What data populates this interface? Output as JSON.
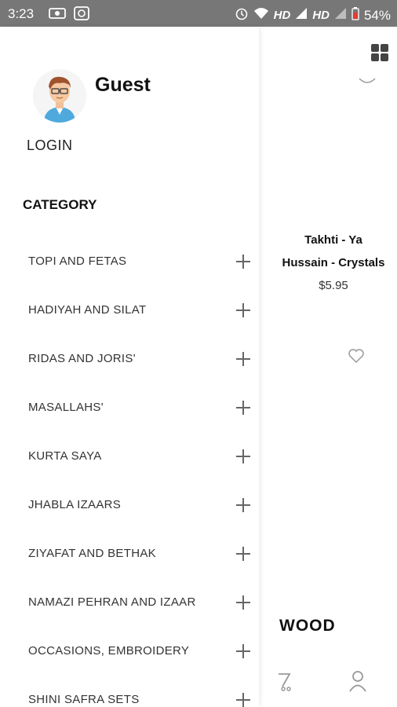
{
  "status_bar": {
    "time": "3:23",
    "network_labels": [
      "HD",
      "HD"
    ],
    "battery": "54%"
  },
  "drawer": {
    "user_name": "Guest",
    "login_label": "LOGIN",
    "category_title": "CATEGORY",
    "categories": [
      "TOPI AND FETAS",
      "HADIYAH AND SILAT",
      "RIDAS AND JORIS'",
      "MASALLAHS'",
      "KURTA SAYA",
      "JHABLA IZAARS",
      "ZIYAFAT AND BETHAK",
      "NAMAZI PEHRAN AND IZAAR",
      "OCCASIONS, EMBROIDERY",
      "SHINI SAFRA SETS"
    ]
  },
  "background": {
    "product": {
      "title_line1": "Takhti - Ya",
      "title_line2": "Hussain - Crystals",
      "price": "$5.95"
    },
    "section_label": "WOOD"
  },
  "icons": [
    "grid-view-icon",
    "heart-icon",
    "cart-icon",
    "account-icon",
    "alarm-icon",
    "wifi-icon",
    "signal-icon",
    "battery-icon"
  ]
}
